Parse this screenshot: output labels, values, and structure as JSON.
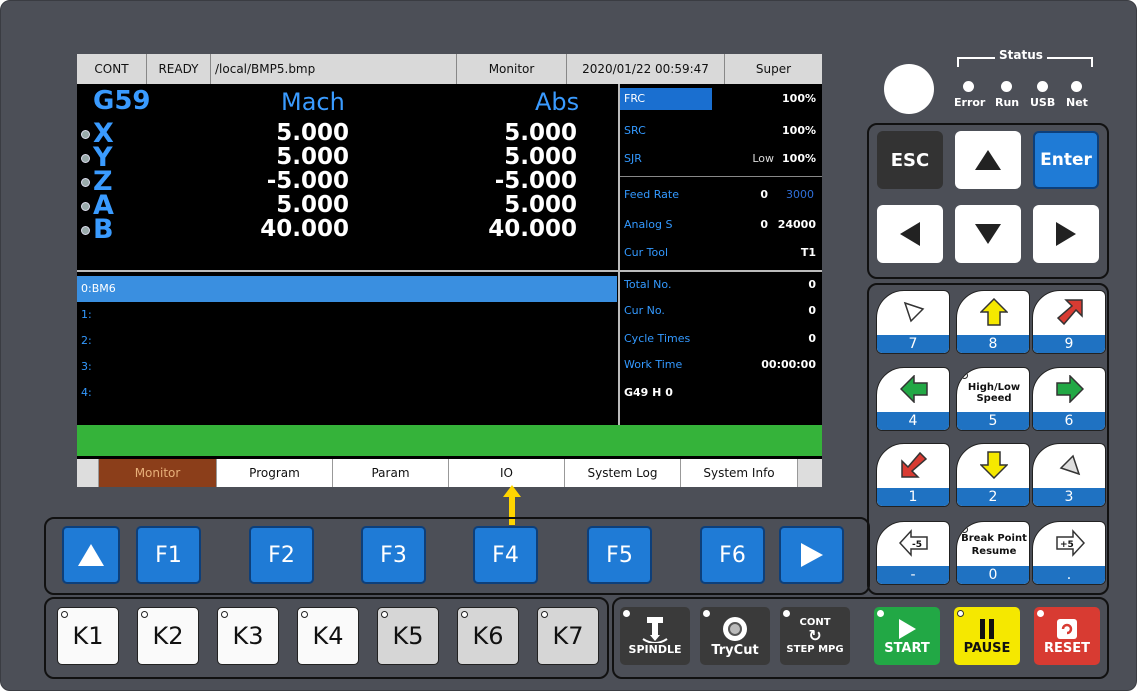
{
  "status_bar": {
    "mode": "CONT",
    "state": "READY",
    "file": "/local/BMP5.bmp",
    "page": "Monitor",
    "datetime": "2020/01/22 00:59:47",
    "user": "Super"
  },
  "coords": {
    "wcs": "G59",
    "mach_header": "Mach",
    "abs_header": "Abs",
    "axes": [
      {
        "name": "X",
        "mach": "5.000",
        "abs": "5.000"
      },
      {
        "name": "Y",
        "mach": "5.000",
        "abs": "5.000"
      },
      {
        "name": "Z",
        "mach": "-5.000",
        "abs": "-5.000"
      },
      {
        "name": "A",
        "mach": "5.000",
        "abs": "5.000"
      },
      {
        "name": "B",
        "mach": "40.000",
        "abs": "40.000"
      }
    ]
  },
  "info_panel": {
    "frc_label": "FRC",
    "frc_value": "100%",
    "src_label": "SRC",
    "src_value": "100%",
    "sjr_label": "SJR",
    "sjr_mode": "Low",
    "sjr_value": "100%",
    "feed_label": "Feed Rate",
    "feed_value": "0",
    "feed_max": "3000",
    "analog_label": "Analog S",
    "analog_value": "0",
    "analog_max": "24000",
    "tool_label": "Cur Tool",
    "tool_value": "T1",
    "total_label": "Total No.",
    "total_value": "0",
    "cur_label": "Cur No.",
    "cur_value": "0",
    "cycle_label": "Cycle Times",
    "cycle_value": "0",
    "work_label": "Work Time",
    "work_value": "00:00:00",
    "gcode": "G49 H 0"
  },
  "program_lines": [
    "0:BM6",
    "1:",
    "2:",
    "3:",
    "4:"
  ],
  "tabs": [
    "Monitor",
    "Program",
    "Param",
    "IO",
    "System Log",
    "System Info"
  ],
  "fkeys": [
    "F1",
    "F2",
    "F3",
    "F4",
    "F5",
    "F6"
  ],
  "kkeys": [
    "K1",
    "K2",
    "K3",
    "K4",
    "K5",
    "K6",
    "K7"
  ],
  "status_leds": {
    "title": "Status",
    "labels": [
      "Error",
      "Run",
      "USB",
      "Net"
    ]
  },
  "nav": {
    "esc": "ESC",
    "enter": "Enter"
  },
  "jog_keys": [
    {
      "num": "7",
      "sym": "XY-"
    },
    {
      "num": "8",
      "sym": "Y+"
    },
    {
      "num": "9",
      "sym": "Z+"
    },
    {
      "num": "4",
      "sym": "X-"
    },
    {
      "num": "5",
      "sym": "High/Low Speed"
    },
    {
      "num": "6",
      "sym": "X+"
    },
    {
      "num": "1",
      "sym": "Z-"
    },
    {
      "num": "2",
      "sym": "Y-"
    },
    {
      "num": "3",
      "sym": "XY"
    },
    {
      "num": "-",
      "sym": "-5"
    },
    {
      "num": "0",
      "sym": "Break Point Resume"
    },
    {
      "num": ".",
      "sym": "+5"
    }
  ],
  "function_keys": {
    "spindle": "SPINDLE",
    "trycut": "TryCut",
    "cont": "CONT",
    "step_mpg": "STEP MPG",
    "start": "START",
    "pause": "PAUSE",
    "reset": "RESET"
  },
  "colors": {
    "panel": "#4c4f57",
    "key_blue": "#1f7bd6",
    "start_green": "#22a845",
    "pause_yellow": "#f5e800",
    "reset_red": "#d83b32",
    "tab_active": "#8b3e1a",
    "prog_highlight": "#3a8fe0",
    "green_bar": "#35b33a"
  }
}
